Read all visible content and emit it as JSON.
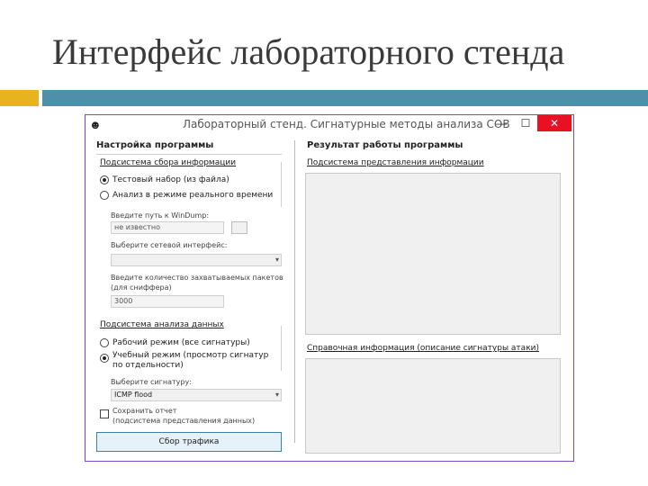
{
  "slide": {
    "title": "Интерфейс лабораторного стенда",
    "accent_color": "#e8b41e",
    "rule_color": "#4e8faa"
  },
  "window": {
    "title": "Лабораторный стенд. Сигнатурные методы анализа СОВ",
    "icon": "app-icon",
    "minimize": "—",
    "maximize": "☐",
    "close": "✕",
    "frame_color": "#7a4bc4",
    "close_color": "#e81123"
  },
  "settings": {
    "header": "Настройка программы",
    "capture": {
      "header": "Подсистема сбора информации",
      "option_file": "Тестовый набор (из файла)",
      "option_realtime": "Анализ в режиме реального времени",
      "selected": "file",
      "path_label": "Введите путь к WinDump:",
      "path_value": "не известно",
      "iface_label": "Выберите сетевой интерфейс:",
      "iface_value": "",
      "packets_label_1": "Введите количество захватываемых пакетов",
      "packets_label_2": "(для сниффера)",
      "packets_value": "3000"
    },
    "analysis": {
      "header": "Подсистема анализа данных",
      "option_work": "Рабочий режим (все сигнатуры)",
      "option_learn_1": "Учебный режим (просмотр сигнатур",
      "option_learn_2": "по отдельности)",
      "selected": "learn",
      "signature_label": "Выберите сигнатуру:",
      "signature_value": "ICMP flood"
    },
    "save_report_1": "Сохранить отчет",
    "save_report_2": "(подсистема представления данных)",
    "save_report_checked": false,
    "capture_button": "Сбор трафика"
  },
  "results": {
    "header": "Результат работы программы",
    "presentation_header": "Подсистема представления информации",
    "reference_header": "Справочная информация (описание сигнатуры атаки)"
  }
}
